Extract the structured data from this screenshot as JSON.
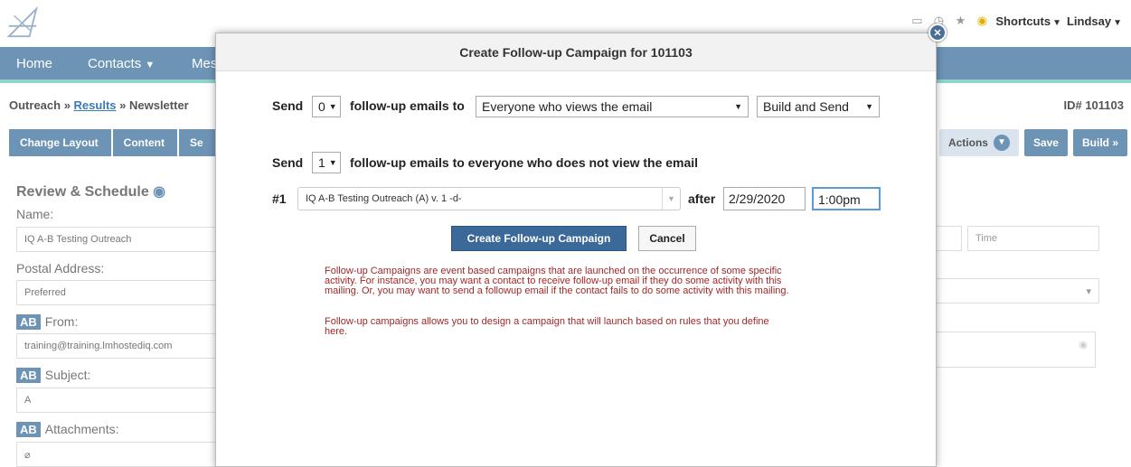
{
  "topbar": {
    "shortcuts_label": "Shortcuts",
    "user_label": "Lindsay"
  },
  "nav": {
    "home": "Home",
    "contacts": "Contacts",
    "messages_partial": "Mes"
  },
  "breadcrumb": {
    "part1": "Outreach",
    "sep": " » ",
    "results": "Results",
    "newsletter": "Newsletter",
    "id_label": "ID# 101103"
  },
  "steps": {
    "change_layout": "Change Layout",
    "content": "Content",
    "partial": "Se",
    "actions": "Actions",
    "save": "Save",
    "build": "Build »"
  },
  "form": {
    "title": "Review & Schedule",
    "name_label": "Name:",
    "name_value": "IQ A-B Testing Outreach",
    "postal_label": "Postal Address:",
    "postal_value": "Preferred",
    "ab_badge": "AB",
    "from_label": "From:",
    "from_value": "training@training.lmhostediq.com",
    "subject_label": "Subject:",
    "subject_value": "A",
    "attachments_label": "Attachments:",
    "time_placeholder": "Time"
  },
  "modal": {
    "title": "Create Follow-up Campaign for 101103",
    "send_label": "Send",
    "count1": "0",
    "followup_to": "follow-up emails to",
    "audience": "Everyone who views the email",
    "mode": "Build and Send",
    "count2": "1",
    "not_view_text": "follow-up emails to everyone who does not view the email",
    "row_num": "#1",
    "campaign": "IQ A-B Testing Outreach (A) v. 1 -d-",
    "after_label": "after",
    "date": "2/29/2020",
    "time": "1:00pm",
    "create_btn": "Create Follow-up Campaign",
    "cancel_btn": "Cancel",
    "note1_l1": "Follow-up Campaigns are event based campaigns that are launched on the occurrence of some specific",
    "note1_l2": "activity.  For instance, you may want a contact to receive follow-up email if they do some activity with this",
    "note1_l3": "mailing. Or, you may want to send a followup email if the contact fails to do some activity with this mailing.",
    "note2_l1": "Follow-up campaigns allows you to design a campaign that will launch based on rules that you define",
    "note2_l2": "here."
  }
}
